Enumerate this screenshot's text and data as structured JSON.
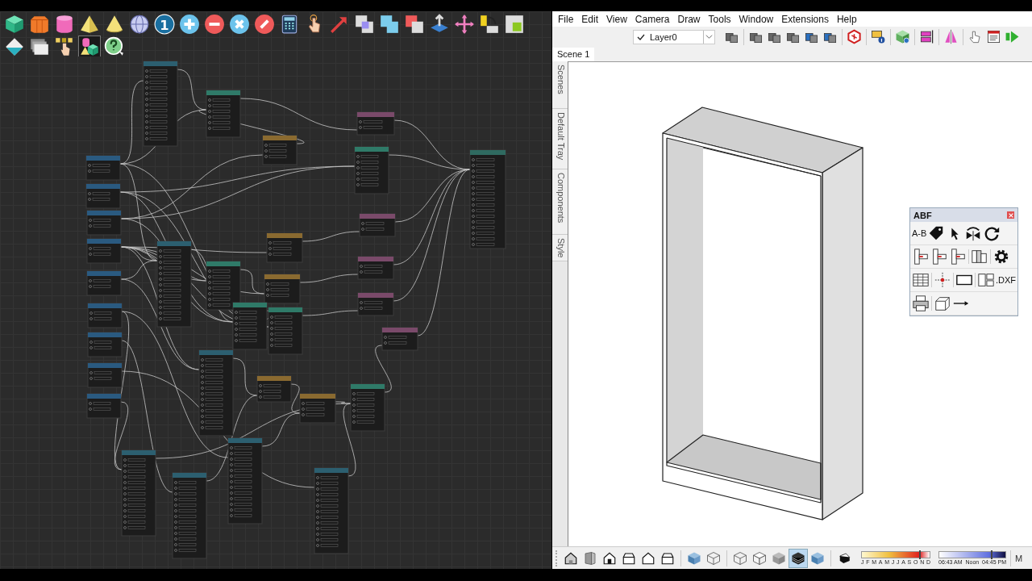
{
  "node_editor": {
    "toolbar_rows": [
      [
        {
          "kind": "cube",
          "selected": false
        },
        {
          "kind": "hex-prism",
          "selected": false
        },
        {
          "kind": "cylinder",
          "selected": false
        },
        {
          "kind": "pyramid",
          "selected": false
        },
        {
          "kind": "cone",
          "selected": false
        },
        {
          "kind": "sphere",
          "selected": false
        },
        {
          "kind": "number",
          "label": "1",
          "selected": false
        },
        {
          "kind": "plus",
          "selected": false
        },
        {
          "kind": "minus",
          "selected": false
        },
        {
          "kind": "multiply",
          "selected": false
        },
        {
          "kind": "divide",
          "selected": false
        },
        {
          "kind": "calculator",
          "selected": false
        },
        {
          "kind": "hand-pointer",
          "selected": false
        },
        {
          "kind": "arrow",
          "selected": false
        },
        {
          "kind": "overlap-purple",
          "selected": false
        },
        {
          "kind": "overlap-blue",
          "selected": false
        },
        {
          "kind": "overlap-red",
          "selected": false
        },
        {
          "kind": "push-pull",
          "selected": false
        },
        {
          "kind": "move-cross",
          "selected": false
        },
        {
          "kind": "rotate-squares",
          "selected": false
        },
        {
          "kind": "scale-squares",
          "selected": false
        }
      ],
      [
        {
          "kind": "diamond-drop",
          "selected": false
        },
        {
          "kind": "stacked-sheets",
          "selected": false
        },
        {
          "kind": "hand-grid",
          "selected": false
        },
        {
          "kind": "shapes",
          "selected": true
        },
        {
          "kind": "help",
          "selected": false
        }
      ]
    ]
  },
  "sketchup": {
    "menu": [
      "File",
      "Edit",
      "View",
      "Camera",
      "Draw",
      "Tools",
      "Window",
      "Extensions",
      "Help"
    ],
    "layer_select": {
      "value": "Layer0",
      "checked": true
    },
    "toolbar": [
      {
        "kind": "grey-boxes"
      },
      {
        "kind": "separator"
      },
      {
        "kind": "grey-boxes"
      },
      {
        "kind": "grey-boxes"
      },
      {
        "kind": "grey-boxes"
      },
      {
        "kind": "blue-boxes"
      },
      {
        "kind": "blue-boxes"
      },
      {
        "kind": "separator"
      },
      {
        "kind": "red-cube"
      },
      {
        "kind": "separator"
      },
      {
        "kind": "info-note"
      },
      {
        "kind": "separator"
      },
      {
        "kind": "green-cube-gear"
      },
      {
        "kind": "separator"
      },
      {
        "kind": "pink-bars"
      },
      {
        "kind": "separator"
      },
      {
        "kind": "mirror-triangles"
      },
      {
        "kind": "separator"
      },
      {
        "kind": "hand-cursor"
      },
      {
        "kind": "table-window"
      },
      {
        "kind": "green-arrow"
      }
    ],
    "scene_tabs": [
      {
        "label": "Scene 1",
        "selected": true
      }
    ],
    "tray_tabs": [
      "Scenes",
      "Default Tray",
      "Components",
      "Style"
    ],
    "abf_panel": {
      "title": "ABF",
      "rows": [
        [
          {
            "kind": "text",
            "label": "A-B"
          },
          {
            "kind": "tag"
          },
          {
            "kind": "cursor"
          },
          {
            "kind": "flip"
          },
          {
            "kind": "refresh"
          }
        ],
        [
          {
            "kind": "panel-edge"
          },
          {
            "kind": "panel-edge"
          },
          {
            "kind": "panel-edge"
          },
          {
            "kind": "separator"
          },
          {
            "kind": "columns"
          },
          {
            "kind": "separator"
          },
          {
            "kind": "gear"
          }
        ],
        [
          {
            "kind": "table"
          },
          {
            "kind": "separator"
          },
          {
            "kind": "move-axes"
          },
          {
            "kind": "separator"
          },
          {
            "kind": "rectangle"
          },
          {
            "kind": "separator"
          },
          {
            "kind": "layout"
          },
          {
            "kind": "text",
            "label": ".DXF"
          }
        ],
        [
          {
            "kind": "printer"
          },
          {
            "kind": "separator"
          },
          {
            "kind": "box3d"
          },
          {
            "kind": "arrow-right"
          }
        ]
      ]
    },
    "status_toolbar": [
      [
        {
          "kind": "house-3d",
          "selected": false
        },
        {
          "kind": "door",
          "selected": false
        },
        {
          "kind": "house",
          "selected": false
        },
        {
          "kind": "house-box",
          "selected": false
        },
        {
          "kind": "house-outline",
          "selected": false
        },
        {
          "kind": "house-box",
          "selected": false
        }
      ],
      [
        {
          "kind": "blue-cube",
          "selected": false
        },
        {
          "kind": "wire-cube",
          "selected": false
        }
      ],
      [
        {
          "kind": "wire-cube",
          "selected": false
        },
        {
          "kind": "white-cube",
          "selected": false
        },
        {
          "kind": "grey-cube",
          "selected": false
        },
        {
          "kind": "striped-cube",
          "selected": true
        },
        {
          "kind": "blue-cube",
          "selected": false
        }
      ],
      [
        {
          "kind": "shadow-box",
          "selected": false
        }
      ]
    ],
    "shadow_months": {
      "labels": [
        "J",
        "F",
        "M",
        "A",
        "M",
        "J",
        "J",
        "A",
        "S",
        "O",
        "N",
        "D"
      ],
      "level": 0.84
    },
    "shadow_time": {
      "start": "06:43 AM",
      "middle": "Noon",
      "end": "04:45 PM",
      "level": 0.78
    },
    "status_cut": "M"
  }
}
